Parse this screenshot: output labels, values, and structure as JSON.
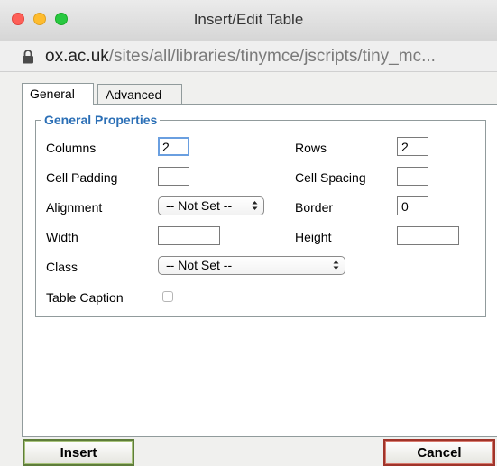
{
  "window": {
    "title": "Insert/Edit Table",
    "url_domain": "ox.ac.uk",
    "url_path": "/sites/all/libraries/tinymce/jscripts/tiny_mc..."
  },
  "tabs": [
    {
      "label": "General",
      "active": true
    },
    {
      "label": "Advanced",
      "active": false
    }
  ],
  "general": {
    "legend": "General Properties",
    "columns_label": "Columns",
    "columns_value": "2",
    "rows_label": "Rows",
    "rows_value": "2",
    "cell_padding_label": "Cell Padding",
    "cell_padding_value": "",
    "cell_spacing_label": "Cell Spacing",
    "cell_spacing_value": "",
    "alignment_label": "Alignment",
    "alignment_value": "-- Not Set --",
    "border_label": "Border",
    "border_value": "0",
    "width_label": "Width",
    "width_value": "",
    "height_label": "Height",
    "height_value": "",
    "class_label": "Class",
    "class_value": "-- Not Set --",
    "caption_label": "Table Caption",
    "caption_checked": false
  },
  "buttons": {
    "insert": "Insert",
    "cancel": "Cancel"
  },
  "colors": {
    "legend": "#2b6fb6",
    "insert_border": "#5e7d3a",
    "cancel_border": "#a0342a"
  }
}
